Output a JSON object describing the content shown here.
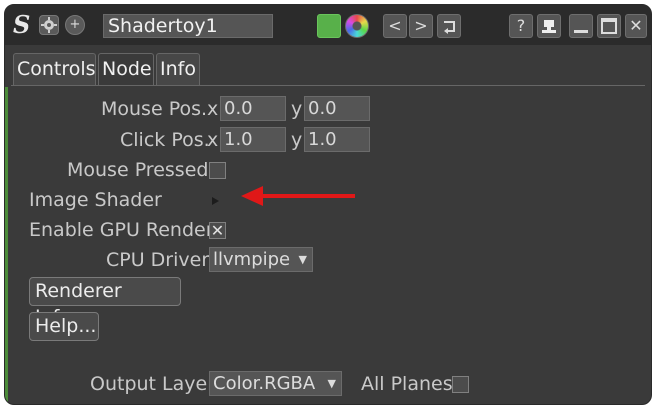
{
  "titlebar": {
    "logo": "S",
    "name": "Shadertoy1",
    "icons": [
      "gear-icon",
      "plus-circle-icon"
    ],
    "right_buttons": [
      "green-swatch",
      "color-wheel-icon",
      "prev-icon",
      "next-icon",
      "revert-icon",
      "help-icon",
      "node-icon",
      "minimize-icon",
      "maximize-icon",
      "close-icon"
    ],
    "labels": {
      "prev": "<",
      "next": ">",
      "help": "?",
      "close": "✕"
    }
  },
  "tabs": [
    {
      "label": "Controls",
      "active": false
    },
    {
      "label": "Node",
      "active": true
    },
    {
      "label": "Info",
      "active": false
    }
  ],
  "mouse_pos": {
    "label": "Mouse Pos.",
    "x_label": "x",
    "x_value": "0.0",
    "y_label": "y",
    "y_value": "0.0"
  },
  "click_pos": {
    "label": "Click Pos.",
    "x_label": "x",
    "x_value": "1.0",
    "y_label": "y",
    "y_value": "1.0"
  },
  "mouse_pressed": {
    "label": "Mouse Pressed",
    "checked": false
  },
  "image_shader": {
    "label": "Image Shader"
  },
  "gpu_render": {
    "label": "Enable GPU Render",
    "checked": true,
    "mark": "✕"
  },
  "cpu_driver": {
    "label": "CPU Driver",
    "value": "llvmpipe"
  },
  "buttons": {
    "renderer_info": "Renderer Info...",
    "help": "Help..."
  },
  "output_layer": {
    "label": "Output Layer",
    "value": "Color.RGBA"
  },
  "all_planes": {
    "label": "All Planes",
    "checked": false
  },
  "colors": {
    "annotation_arrow": "#e01818",
    "accent_green": "#58b04a"
  }
}
